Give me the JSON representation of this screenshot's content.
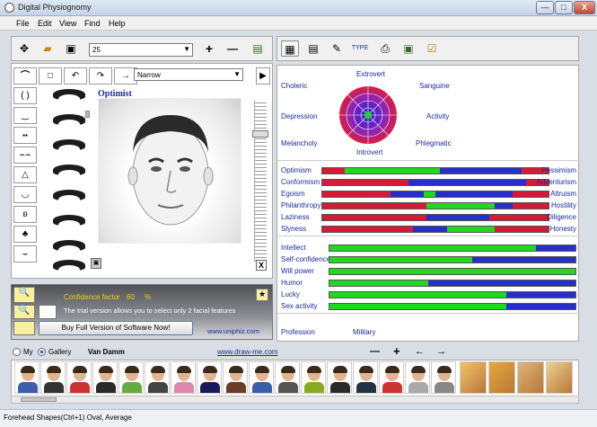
{
  "window": {
    "title": "Digital Physiognomy",
    "min": "—",
    "max": "□",
    "close": "X"
  },
  "menu": [
    "File",
    "Edit",
    "View",
    "Find",
    "Help"
  ],
  "toolbar": {
    "combo_value": "25",
    "plus": "+",
    "minus": "—"
  },
  "editor": {
    "shape_combo": "Narrow",
    "face_label": "Optimist",
    "close_x": "X"
  },
  "info": {
    "confidence_label": "Confidence factor",
    "confidence_value": "60",
    "confidence_unit": "%",
    "trial_text": "The trial version allows you to select only 2 facial features",
    "buy_button": "Buy Full Version of Software Now!",
    "site": "www.uniphiz.com"
  },
  "temperament": {
    "labels": {
      "extrovert": "Extrovert",
      "introvert": "Introvert",
      "choleric": "Choleric",
      "sanguine": "Sanguine",
      "depression": "Depression",
      "activity": "Activity",
      "melancholy": "Melancholy",
      "phlegmatic": "Phlegmatic"
    }
  },
  "traits_pairs": [
    {
      "left": "Optimism",
      "right": "Pessimism",
      "red1": 0.1,
      "green": [
        0.1,
        0.52
      ],
      "blue": [
        0.52,
        0.88
      ]
    },
    {
      "left": "Conformism",
      "right": "Adventurism",
      "red1": 0.38,
      "green": null,
      "blue": [
        0.38,
        0.9
      ]
    },
    {
      "left": "Egoism",
      "right": "Altruism",
      "red1": 0.3,
      "green": [
        0.45,
        0.5
      ],
      "blue": [
        0.3,
        0.84
      ]
    },
    {
      "left": "Philanthropy",
      "right": "Hostility",
      "red1": 0.46,
      "green": [
        0.46,
        0.76
      ],
      "blue": [
        0.76,
        0.84
      ]
    },
    {
      "left": "Laziness",
      "right": "Diligence",
      "red1": 0.46,
      "green": null,
      "blue": [
        0.46,
        0.74
      ]
    },
    {
      "left": "Slyness",
      "right": "Honesty",
      "red1": 0.4,
      "green": [
        0.55,
        0.76
      ],
      "blue": [
        0.4,
        0.55
      ]
    }
  ],
  "traits_single": [
    {
      "label": "Intellect",
      "green": 0.84
    },
    {
      "label": "Self-confidence",
      "green": 0.58
    },
    {
      "label": "Will power",
      "green": 1.0
    },
    {
      "label": "Humor",
      "green": 0.4
    },
    {
      "label": "Lucky",
      "green": 0.72
    },
    {
      "label": "Sex activity",
      "green": 0.72
    }
  ],
  "profession": {
    "label": "Profession",
    "value": "Military"
  },
  "gallery": {
    "my_label": "My",
    "gallery_label": "Gallery",
    "name": "Van Damm",
    "link": "www.draw-me.com",
    "minus": "—",
    "plus": "+",
    "left": "←",
    "right": "→"
  },
  "status": "Forehead Shapes(Ctrl+1) Oval, Average",
  "colors": {
    "red": "#d41a36",
    "green": "#1fd81f",
    "blue": "#2630c8",
    "purple": "#7a2c99"
  }
}
